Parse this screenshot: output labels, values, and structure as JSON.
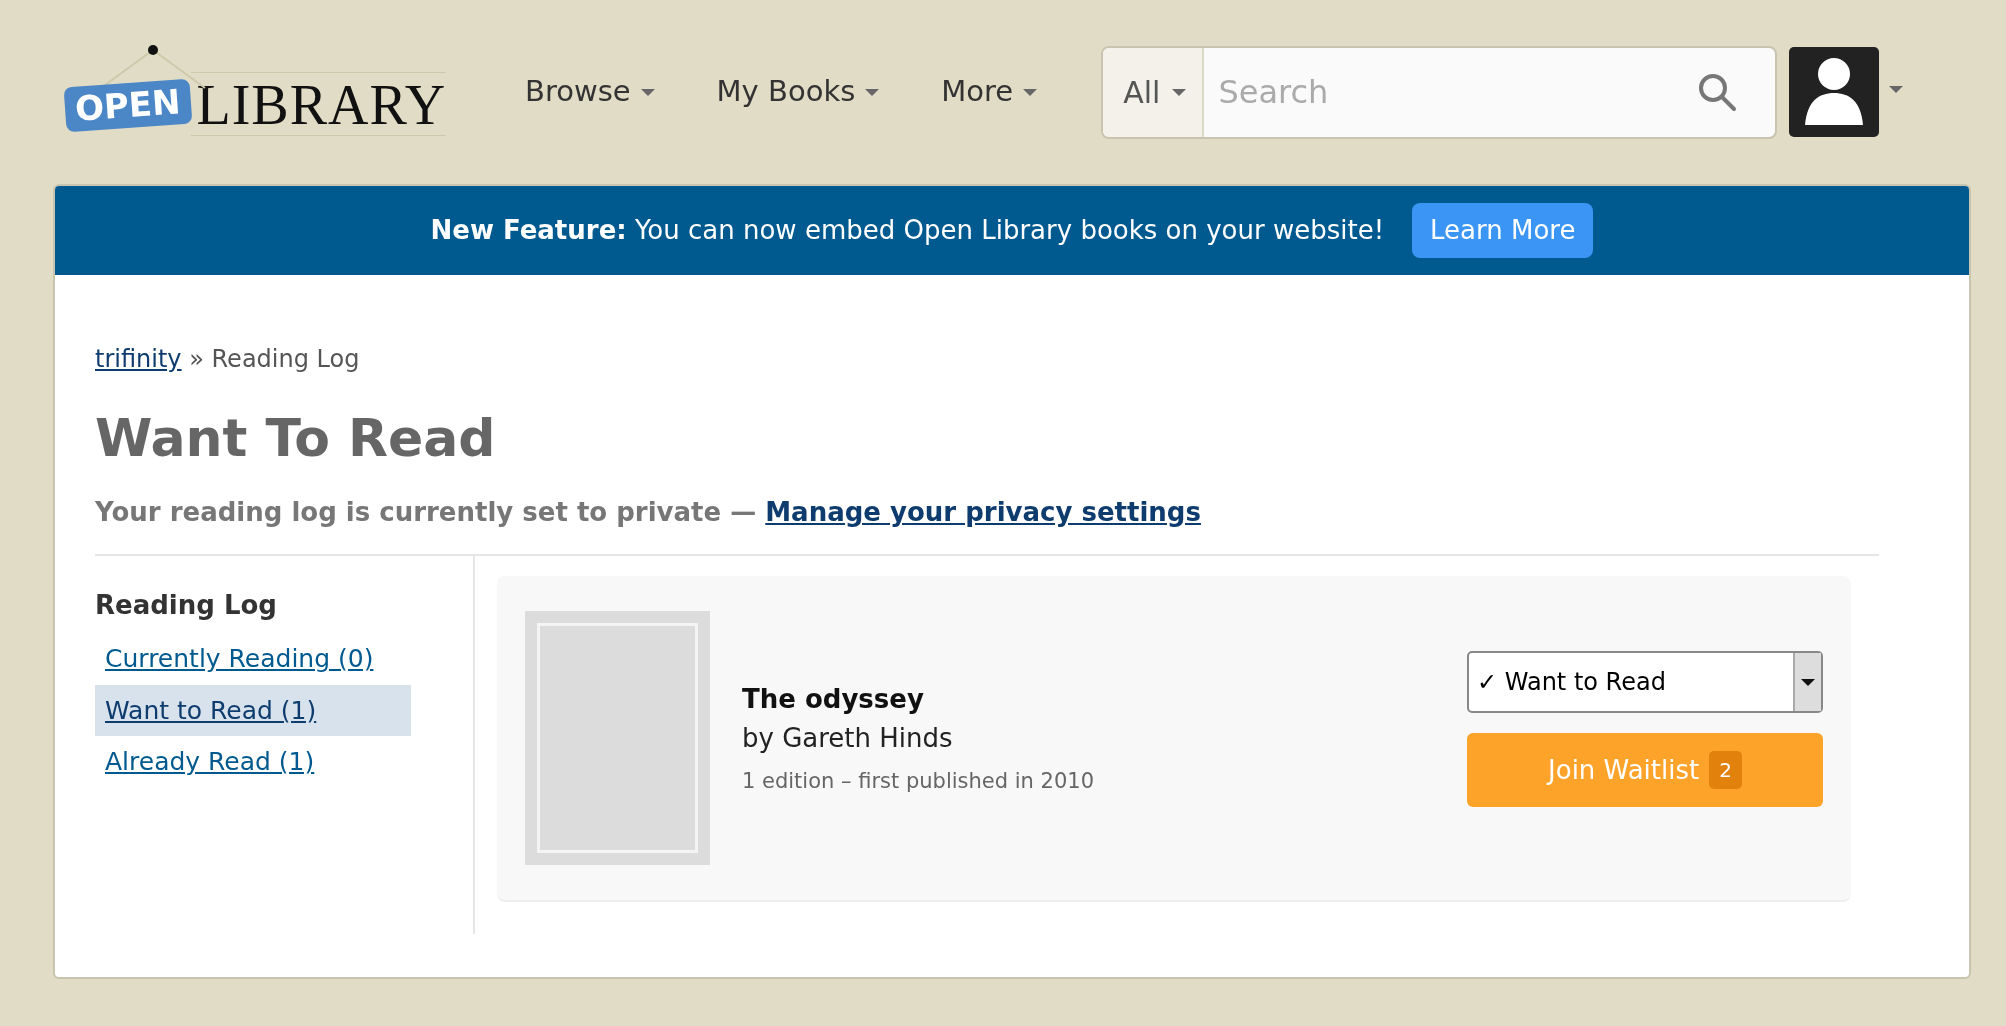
{
  "header": {
    "logo": {
      "badge": "OPEN",
      "wordmark": "LIBRARY"
    },
    "nav": [
      {
        "label": "Browse"
      },
      {
        "label": "My Books"
      },
      {
        "label": "More"
      }
    ],
    "search": {
      "scope": "All",
      "placeholder": "Search"
    }
  },
  "banner": {
    "text": "**New Feature:** You can now embed Open Library books on your website!",
    "button": "Learn More"
  },
  "breadcrumb": {
    "link": "trifinity",
    "separator": "»",
    "current": "Reading Log"
  },
  "title": "Want To Read",
  "privacy": {
    "text": "Your reading log is currently set to private —",
    "link": "Manage your privacy settings"
  },
  "sidebar": {
    "heading": "Reading Log",
    "items": [
      {
        "label": "Currently Reading (0)",
        "selected": false
      },
      {
        "label": "Want to Read (1)",
        "selected": true
      },
      {
        "label": "Already Read (1)",
        "selected": false
      }
    ]
  },
  "books": [
    {
      "title": "The odyssey",
      "author": "by Gareth Hinds",
      "meta": "1 edition – first published in 2010",
      "shelf": "✓ Want to Read",
      "action": "Join Waitlist",
      "waitlist_count": "2"
    }
  ]
}
